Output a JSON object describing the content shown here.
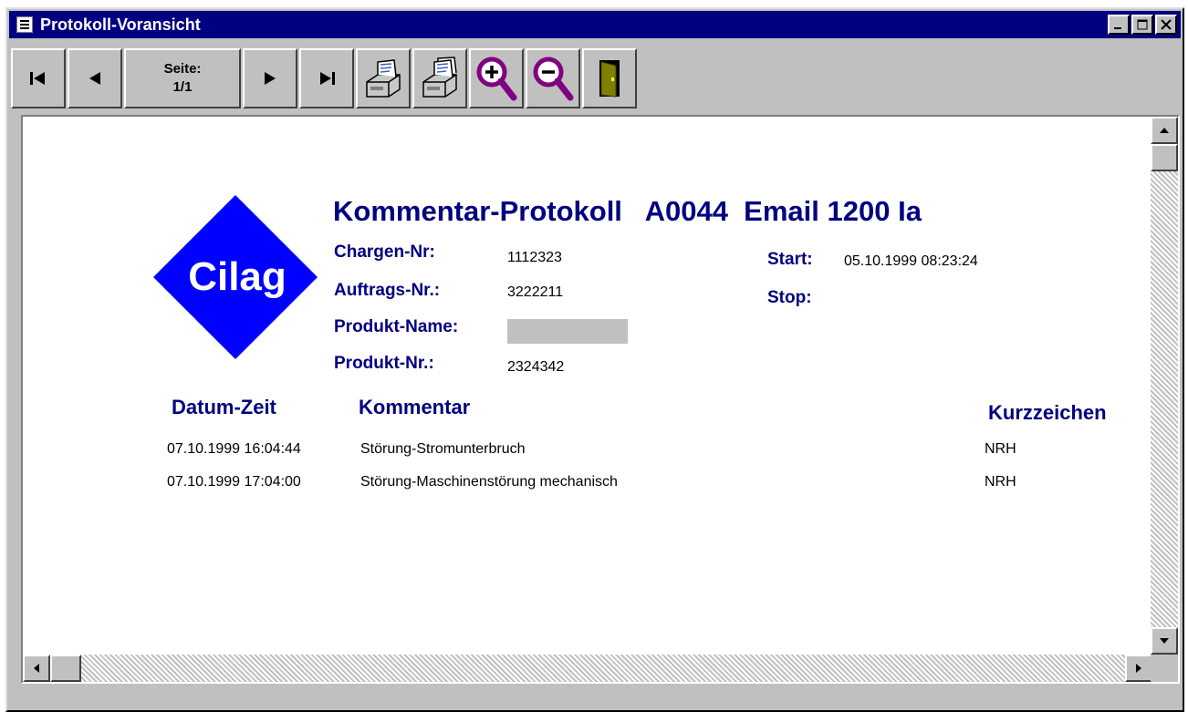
{
  "window": {
    "title": "Protokoll-Voransicht",
    "buttons": {
      "minimize": "_",
      "maximize": "□",
      "close": "✕"
    }
  },
  "toolbar": {
    "page_label": "Seite:",
    "page_value": "1/1",
    "icons": [
      "first-page-icon",
      "prev-page-icon",
      "next-page-icon",
      "last-page-icon",
      "print-icon",
      "print-multiple-icon",
      "zoom-in-icon",
      "zoom-out-icon",
      "exit-door-icon"
    ]
  },
  "report": {
    "logo_text": "Cilag",
    "title": "Kommentar-Protokoll   A0044  Email 1200 Ia",
    "fields": {
      "chargen_label": "Chargen-Nr:",
      "chargen_value": "1112323",
      "auftrags_label": "Auftrags-Nr.:",
      "auftrags_value": "3222211",
      "produktname_label": "Produkt-Name:",
      "produktnr_label": "Produkt-Nr.:",
      "produktnr_value": "2324342",
      "start_label": "Start:",
      "start_value": "05.10.1999 08:23:24",
      "stop_label": "Stop:"
    },
    "columns": {
      "datetime": "Datum-Zeit",
      "comment": "Kommentar",
      "initials": "Kurzzeichen"
    },
    "rows": [
      {
        "datetime": "07.10.1999 16:04:44",
        "comment": "Störung-Stromunterbruch",
        "initials": "NRH"
      },
      {
        "datetime": "07.10.1999 17:04:00",
        "comment": "Störung-Maschinenstörung mechanisch",
        "initials": "NRH"
      }
    ]
  },
  "colors": {
    "title_bar": "#000080",
    "label": "#000080",
    "logo": "#0000ff",
    "zoom_icon": "#800080"
  }
}
